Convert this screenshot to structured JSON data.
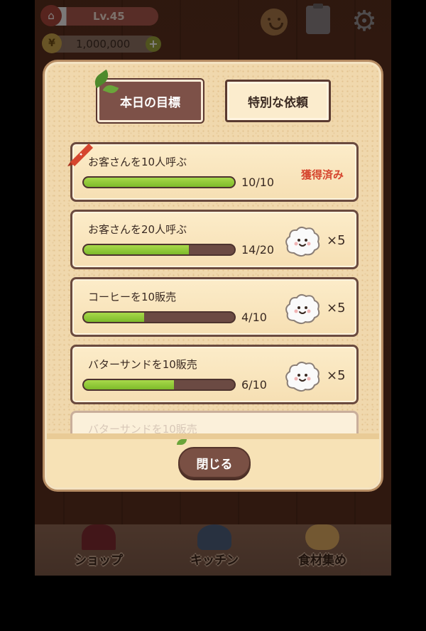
{
  "hud": {
    "level": "Lv.45",
    "money": "1,000,000",
    "yen_symbol": "¥",
    "plus_symbol": "+",
    "icons": [
      "home-icon",
      "face-icon",
      "clipboard-icon",
      "gear-icon"
    ]
  },
  "modal": {
    "tabs": {
      "daily": "本日の目標",
      "special": "特別な依頼"
    },
    "goals": [
      {
        "title": "お客さんを10人呼ぶ",
        "progress": 10,
        "target": 10,
        "count": "10/10",
        "status": "獲得済み",
        "claimed": true,
        "reward_icon": "cloud-mascot-icon"
      },
      {
        "title": "お客さんを20人呼ぶ",
        "progress": 14,
        "target": 20,
        "count": "14/20",
        "multiplier": "×5",
        "claimed": false,
        "reward_icon": "cloud-mascot-icon"
      },
      {
        "title": "コーヒーを10販売",
        "progress": 4,
        "target": 10,
        "count": "4/10",
        "multiplier": "×5",
        "claimed": false,
        "reward_icon": "cloud-mascot-icon"
      },
      {
        "title": "バターサンドを10販売",
        "progress": 6,
        "target": 10,
        "count": "6/10",
        "multiplier": "×5",
        "claimed": false,
        "reward_icon": "cloud-mascot-icon"
      }
    ],
    "partial_goal_title": "バターサンドを10販売",
    "close_label": "閉じる"
  },
  "bottom_nav": {
    "shop": "ショップ",
    "kitchen": "キッチン",
    "gather": "食材集め"
  },
  "colors": {
    "progress_fill": "#7dbb2a",
    "claimed_text": "#d6462f",
    "active_tab": "#7d5148"
  }
}
